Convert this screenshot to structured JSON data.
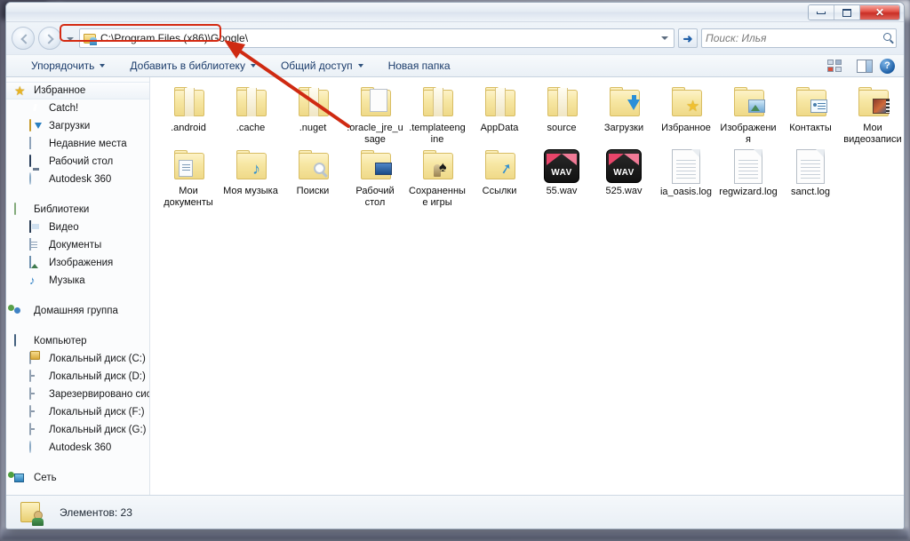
{
  "window": {
    "controls": {
      "minimize": "—",
      "maximize": "□",
      "close": "✕"
    }
  },
  "address": {
    "path": "C:\\Program Files (x86)\\Google\\",
    "icon": "folder-user-icon",
    "dropdown_icon": "chevron-down-icon",
    "go_label": "➜"
  },
  "search": {
    "placeholder": "Поиск: Илья",
    "icon": "search-icon"
  },
  "toolbar": {
    "items": [
      {
        "label": "Упорядочить",
        "has_caret": true
      },
      {
        "label": "Добавить в библиотеку",
        "has_caret": true
      },
      {
        "label": "Общий доступ",
        "has_caret": true
      },
      {
        "label": "Новая папка",
        "has_caret": false
      }
    ],
    "view_icon": "view-layout-icon",
    "view_caret": "chevron-down-icon",
    "pane_icon": "preview-pane-icon",
    "help_icon": "help-icon",
    "help_glyph": "?"
  },
  "sidebar": {
    "groups": [
      {
        "root": {
          "label": "Избранное",
          "icon": "star-icon",
          "selected": true
        },
        "items": [
          {
            "label": "Catch!",
            "icon": "catch-icon"
          },
          {
            "label": "Загрузки",
            "icon": "downloads-icon"
          },
          {
            "label": "Недавние места",
            "icon": "recent-places-icon"
          },
          {
            "label": "Рабочий стол",
            "icon": "desktop-icon"
          },
          {
            "label": "Autodesk 360",
            "icon": "autodesk-icon"
          }
        ]
      },
      {
        "root": {
          "label": "Библиотеки",
          "icon": "libraries-icon",
          "selected": false
        },
        "items": [
          {
            "label": "Видео",
            "icon": "video-icon"
          },
          {
            "label": "Документы",
            "icon": "documents-icon"
          },
          {
            "label": "Изображения",
            "icon": "pictures-icon"
          },
          {
            "label": "Музыка",
            "icon": "music-icon"
          }
        ]
      },
      {
        "root": {
          "label": "Домашняя группа",
          "icon": "homegroup-icon",
          "selected": false
        },
        "items": []
      },
      {
        "root": {
          "label": "Компьютер",
          "icon": "computer-icon",
          "selected": false
        },
        "items": [
          {
            "label": "Локальный диск (C:)",
            "icon": "system-disk-icon"
          },
          {
            "label": "Локальный диск (D:)",
            "icon": "disk-icon"
          },
          {
            "label": "Зарезервировано систе",
            "icon": "disk-icon"
          },
          {
            "label": "Локальный диск (F:)",
            "icon": "disk-icon"
          },
          {
            "label": "Локальный диск (G:)",
            "icon": "disk-icon"
          },
          {
            "label": "Autodesk 360",
            "icon": "autodesk-icon"
          }
        ]
      },
      {
        "root": {
          "label": "Сеть",
          "icon": "network-icon",
          "selected": false
        },
        "items": []
      }
    ]
  },
  "files": [
    {
      "name": ".android",
      "type": "folder"
    },
    {
      "name": ".cache",
      "type": "folder"
    },
    {
      "name": ".nuget",
      "type": "folder"
    },
    {
      "name": ".oracle_jre_usage",
      "type": "folder-open"
    },
    {
      "name": ".templateengine",
      "type": "folder"
    },
    {
      "name": "AppData",
      "type": "folder"
    },
    {
      "name": "source",
      "type": "folder"
    },
    {
      "name": "Загрузки",
      "type": "folder-downloads"
    },
    {
      "name": "Избранное",
      "type": "folder-favorites"
    },
    {
      "name": "Изображения",
      "type": "folder-pictures"
    },
    {
      "name": "Контакты",
      "type": "folder-contacts"
    },
    {
      "name": "Мои видеозаписи",
      "type": "folder-videos"
    },
    {
      "name": "Мои документы",
      "type": "folder-documents"
    },
    {
      "name": "Моя музыка",
      "type": "folder-music"
    },
    {
      "name": "Поиски",
      "type": "folder-searches"
    },
    {
      "name": "Рабочий стол",
      "type": "folder-desktop"
    },
    {
      "name": "Сохраненные игры",
      "type": "folder-games"
    },
    {
      "name": "Ссылки",
      "type": "folder-links"
    },
    {
      "name": "55.wav",
      "type": "wav",
      "badge": "WAV"
    },
    {
      "name": "525.wav",
      "type": "wav",
      "badge": "WAV"
    },
    {
      "name": "ia_oasis.log",
      "type": "log"
    },
    {
      "name": "regwizard.log",
      "type": "log"
    },
    {
      "name": "sanct.log",
      "type": "log"
    }
  ],
  "status": {
    "text": "Элементов: 23",
    "icon": "folder-user-icon"
  },
  "annotation": {
    "color": "#d42a12",
    "highlight": "address-bar-outline",
    "arrow": "points-to-address-bar"
  }
}
